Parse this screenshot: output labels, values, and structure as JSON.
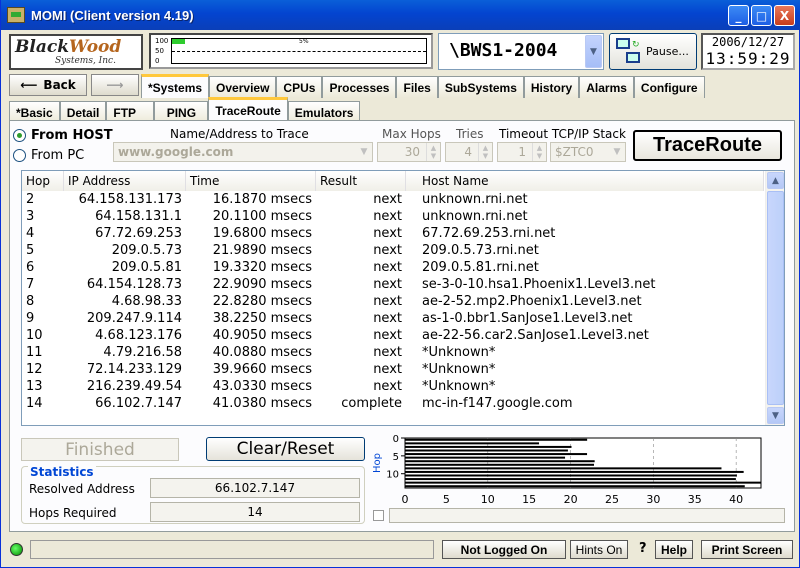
{
  "window": {
    "title": "MOMI (Client version 4.19)",
    "controls": [
      "_",
      "□",
      "X"
    ]
  },
  "logo": {
    "line1a": "Black",
    "line1b": "Wood",
    "line2": "Systems, Inc."
  },
  "cpu_graph": {
    "scale": [
      "100",
      "50",
      "0"
    ],
    "percent_label": "5%",
    "value_percent": 5
  },
  "system_select": {
    "value": "\\BWS1-2004"
  },
  "pause_button": {
    "label": "Pause..."
  },
  "clock": {
    "date": "2006/12/27",
    "time": "13:59:29"
  },
  "nav": {
    "back": "Back",
    "forward": ""
  },
  "main_tabs": [
    "*Systems",
    "Overview",
    "CPUs",
    "Processes",
    "Files",
    "SubSystems",
    "History",
    "Alarms",
    "Configure"
  ],
  "main_tab_active": "*Systems",
  "sub_tabs": [
    "*Basic",
    "Detail",
    "FTP",
    "PING",
    "TraceRoute",
    "Emulators"
  ],
  "sub_tab_active": "TraceRoute",
  "form": {
    "from_host": "From HOST",
    "from_pc": "From PC",
    "name_label": "Name/Address to Trace",
    "name_value": "www.google.com",
    "max_hops_label": "Max Hops",
    "max_hops_value": "30",
    "tries_label": "Tries",
    "tries_value": "4",
    "timeout_label": "Timeout TCP/IP Stack",
    "timeout_value": "1",
    "stack_value": "$ZTC0",
    "trace_button": "TraceRoute"
  },
  "table": {
    "headers": [
      "Hop",
      "IP Address",
      "Time",
      "Result",
      "Host Name"
    ],
    "rows": [
      [
        "2",
        "64.158.131.173",
        "16.1870 msecs",
        "next",
        "unknown.rni.net"
      ],
      [
        "3",
        "64.158.131.1",
        "20.1100 msecs",
        "next",
        "unknown.rni.net"
      ],
      [
        "4",
        "67.72.69.253",
        "19.6800 msecs",
        "next",
        "67.72.69.253.rni.net"
      ],
      [
        "5",
        "209.0.5.73",
        "21.9890 msecs",
        "next",
        "209.0.5.73.rni.net"
      ],
      [
        "6",
        "209.0.5.81",
        "19.3320 msecs",
        "next",
        "209.0.5.81.rni.net"
      ],
      [
        "7",
        "64.154.128.73",
        "22.9090 msecs",
        "next",
        "se-3-0-10.hsa1.Phoenix1.Level3.net"
      ],
      [
        "8",
        "4.68.98.33",
        "22.8280 msecs",
        "next",
        "ae-2-52.mp2.Phoenix1.Level3.net"
      ],
      [
        "9",
        "209.247.9.114",
        "38.2250 msecs",
        "next",
        "as-1-0.bbr1.SanJose1.Level3.net"
      ],
      [
        "10",
        "4.68.123.176",
        "40.9050 msecs",
        "next",
        "ae-22-56.car2.SanJose1.Level3.net"
      ],
      [
        "11",
        "4.79.216.58",
        "40.0880 msecs",
        "next",
        "*Unknown*"
      ],
      [
        "12",
        "72.14.233.129",
        "39.9660 msecs",
        "next",
        "*Unknown*"
      ],
      [
        "13",
        "216.239.49.54",
        "43.0330 msecs",
        "next",
        "*Unknown*"
      ],
      [
        "14",
        "66.102.7.147",
        "41.0380 msecs",
        "complete",
        "mc-in-f147.google.com"
      ]
    ]
  },
  "buttons": {
    "finished": "Finished",
    "clear_reset": "Clear/Reset"
  },
  "statistics": {
    "title": "Statistics",
    "resolved_label": "Resolved Address",
    "resolved_value": "66.102.7.147",
    "hops_label": "Hops Required",
    "hops_value": "14"
  },
  "chart_data": {
    "type": "bar",
    "orientation": "horizontal",
    "ylabel": "Hop",
    "y_ticks": [
      "0",
      "5",
      "10"
    ],
    "x_ticks": [
      "0",
      "5",
      "10",
      "15",
      "20",
      "25",
      "30",
      "35",
      "40"
    ],
    "xlim": [
      0,
      43
    ],
    "ylim": [
      0,
      14
    ],
    "categories": [
      1,
      2,
      3,
      4,
      5,
      6,
      7,
      8,
      9,
      10,
      11,
      12,
      13,
      14
    ],
    "values": [
      22,
      16.187,
      20.11,
      19.68,
      21.989,
      19.332,
      22.909,
      22.828,
      38.225,
      40.905,
      40.088,
      39.966,
      43.033,
      41.038
    ]
  },
  "statusbar": {
    "not_logged_on": "Not Logged On",
    "hints_on": "Hints On",
    "question": "?",
    "help": "Help",
    "print_screen": "Print Screen"
  }
}
